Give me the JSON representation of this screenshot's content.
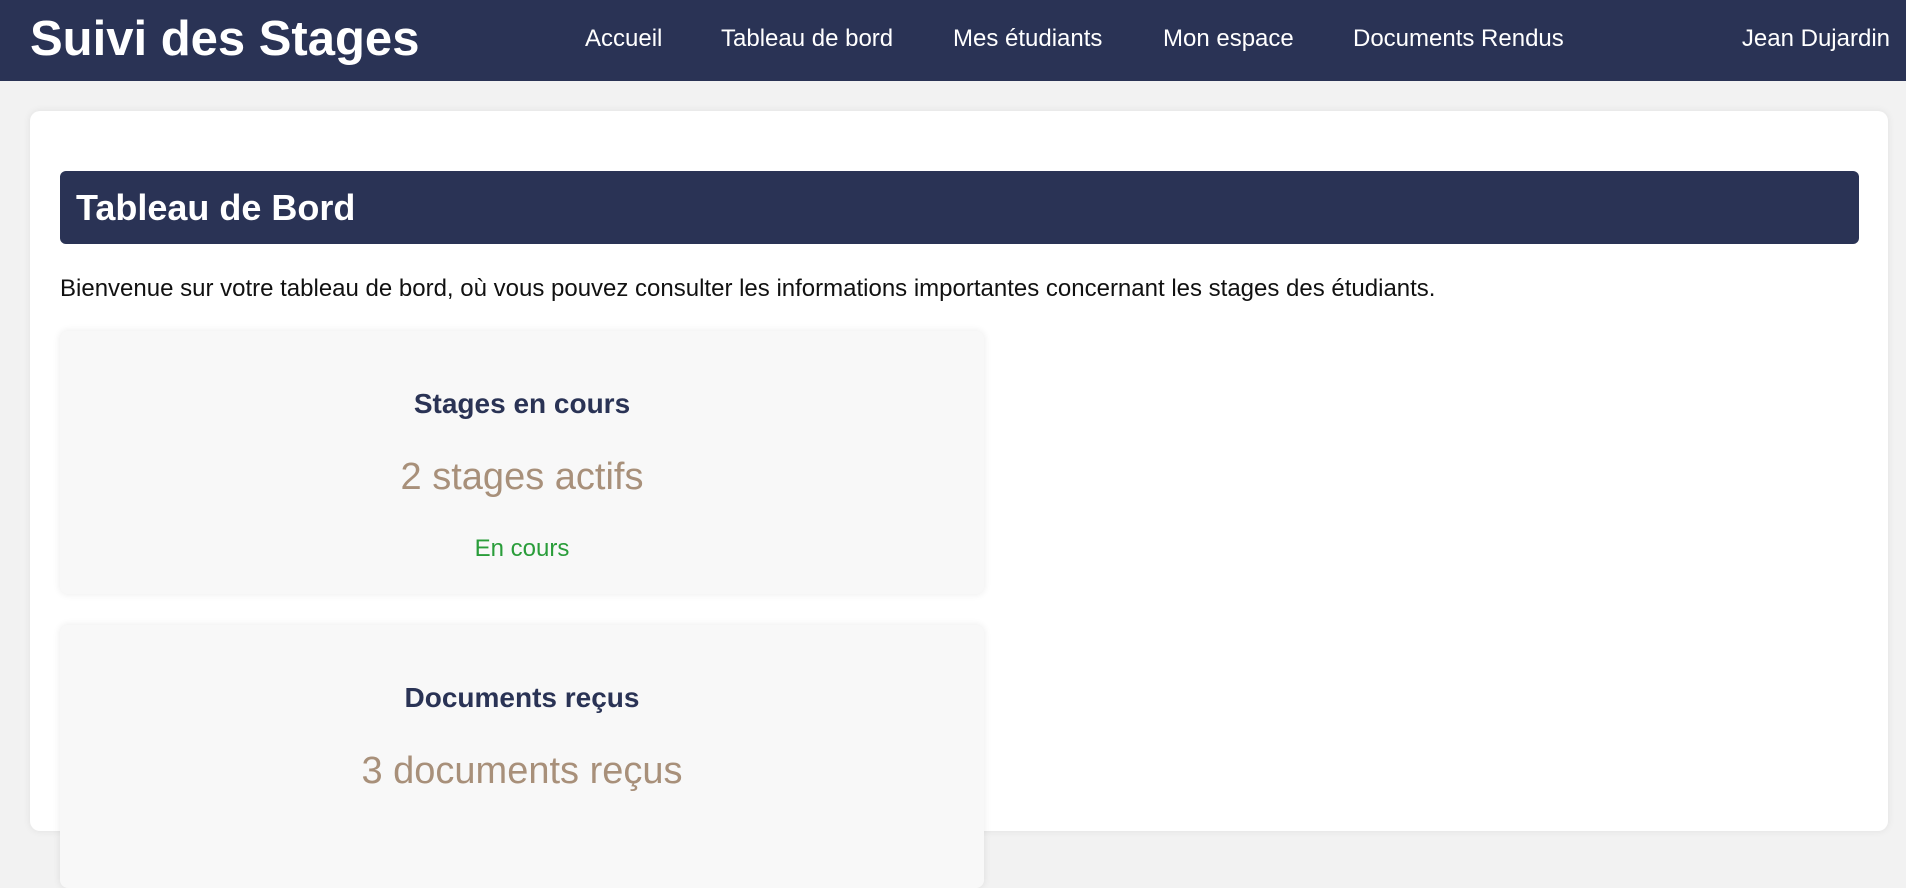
{
  "header": {
    "brand": "Suivi des Stages",
    "nav": [
      {
        "label": "Accueil"
      },
      {
        "label": "Tableau de bord"
      },
      {
        "label": "Mes étudiants"
      },
      {
        "label": "Mon espace"
      },
      {
        "label": "Documents Rendus"
      }
    ],
    "user": "Jean Dujardin"
  },
  "main": {
    "title": "Tableau de Bord",
    "intro": "Bienvenue sur votre tableau de bord, où vous pouvez consulter les informations importantes concernant les stages des étudiants.",
    "cards": [
      {
        "title": "Stages en cours",
        "value": "2 stages actifs",
        "status": "En cours"
      },
      {
        "title": "Documents reçus",
        "value": "3 documents reçus"
      }
    ]
  },
  "colors": {
    "primary": "#2a3355",
    "accent_value": "#a8907a",
    "status_green": "#2a9d3a",
    "background": "#f2f2f2"
  }
}
